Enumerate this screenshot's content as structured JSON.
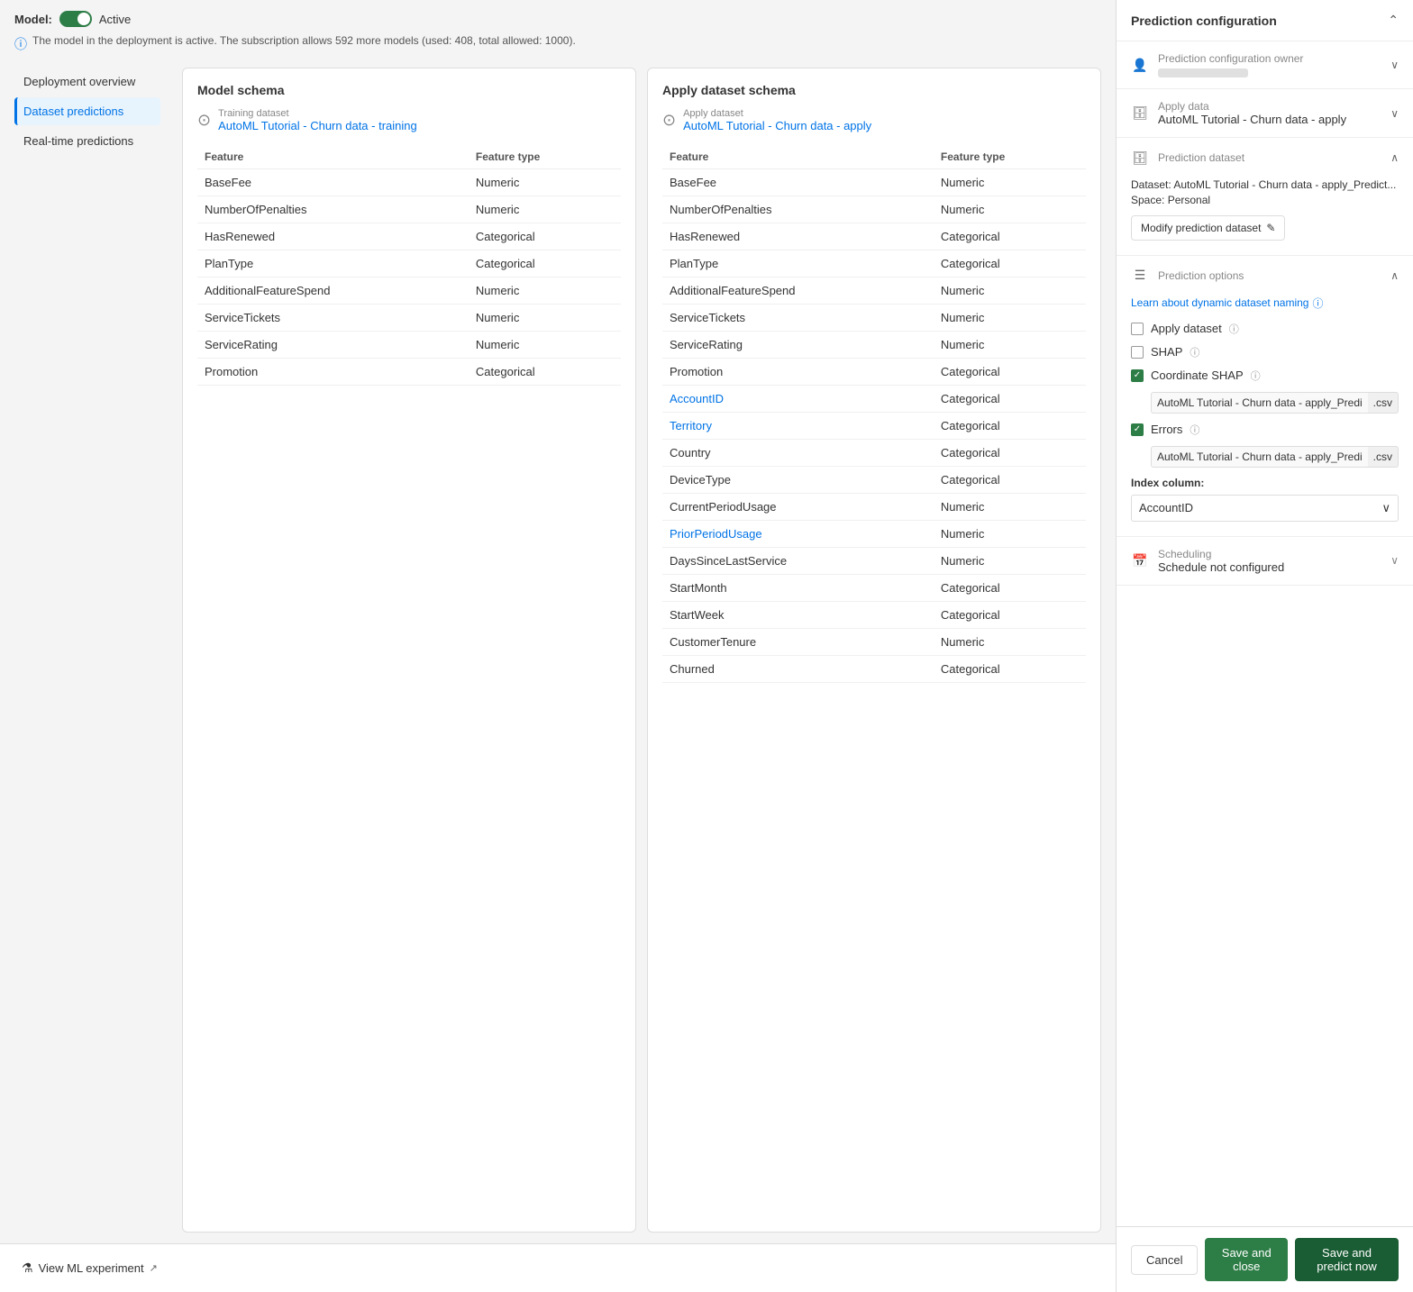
{
  "model": {
    "label": "Model:",
    "status": "Active",
    "info_text": "The model in the deployment is active. The subscription allows 592 more models (used: 408, total allowed: 1000)."
  },
  "sidebar": {
    "items": [
      {
        "id": "deployment-overview",
        "label": "Deployment overview",
        "active": false
      },
      {
        "id": "dataset-predictions",
        "label": "Dataset predictions",
        "active": true
      },
      {
        "id": "real-time-predictions",
        "label": "Real-time predictions",
        "active": false
      }
    ]
  },
  "model_schema": {
    "title": "Model schema",
    "dataset_label": "Training dataset",
    "dataset_name": "AutoML Tutorial - Churn data - training",
    "col_feature": "Feature",
    "col_feature_type": "Feature type",
    "rows": [
      {
        "feature": "BaseFee",
        "type": "Numeric",
        "linked": false
      },
      {
        "feature": "NumberOfPenalties",
        "type": "Numeric",
        "linked": false
      },
      {
        "feature": "HasRenewed",
        "type": "Categorical",
        "linked": false
      },
      {
        "feature": "PlanType",
        "type": "Categorical",
        "linked": false
      },
      {
        "feature": "AdditionalFeatureSpend",
        "type": "Numeric",
        "linked": false
      },
      {
        "feature": "ServiceTickets",
        "type": "Numeric",
        "linked": false
      },
      {
        "feature": "ServiceRating",
        "type": "Numeric",
        "linked": false
      },
      {
        "feature": "Promotion",
        "type": "Categorical",
        "linked": false
      }
    ]
  },
  "apply_schema": {
    "title": "Apply dataset schema",
    "dataset_label": "Apply dataset",
    "dataset_name": "AutoML Tutorial - Churn data - apply",
    "col_feature": "Feature",
    "col_feature_type": "Feature type",
    "rows": [
      {
        "feature": "BaseFee",
        "type": "Numeric",
        "linked": false
      },
      {
        "feature": "NumberOfPenalties",
        "type": "Numeric",
        "linked": false
      },
      {
        "feature": "HasRenewed",
        "type": "Categorical",
        "linked": false
      },
      {
        "feature": "PlanType",
        "type": "Categorical",
        "linked": false
      },
      {
        "feature": "AdditionalFeatureSpend",
        "type": "Numeric",
        "linked": false
      },
      {
        "feature": "ServiceTickets",
        "type": "Numeric",
        "linked": false
      },
      {
        "feature": "ServiceRating",
        "type": "Numeric",
        "linked": false
      },
      {
        "feature": "Promotion",
        "type": "Categorical",
        "linked": false
      },
      {
        "feature": "AccountID",
        "type": "Categorical",
        "linked": true
      },
      {
        "feature": "Territory",
        "type": "Categorical",
        "linked": true
      },
      {
        "feature": "Country",
        "type": "Categorical",
        "linked": false
      },
      {
        "feature": "DeviceType",
        "type": "Categorical",
        "linked": false
      },
      {
        "feature": "CurrentPeriodUsage",
        "type": "Numeric",
        "linked": false
      },
      {
        "feature": "PriorPeriodUsage",
        "type": "Numeric",
        "linked": true
      },
      {
        "feature": "DaysSinceLastService",
        "type": "Numeric",
        "linked": false
      },
      {
        "feature": "StartMonth",
        "type": "Categorical",
        "linked": false
      },
      {
        "feature": "StartWeek",
        "type": "Categorical",
        "linked": false
      },
      {
        "feature": "CustomerTenure",
        "type": "Numeric",
        "linked": false
      },
      {
        "feature": "Churned",
        "type": "Categorical",
        "linked": false
      }
    ]
  },
  "view_experiment": {
    "label": "View ML experiment",
    "icon": "flask"
  },
  "right_panel": {
    "title": "Prediction configuration",
    "window_icon": "□",
    "sections": {
      "owner": {
        "label": "Prediction configuration owner",
        "value": ""
      },
      "apply_data": {
        "label": "Apply data",
        "value": "AutoML Tutorial - Churn data - apply"
      },
      "prediction_dataset": {
        "label": "Prediction dataset",
        "dataset_text": "Dataset: AutoML Tutorial - Churn data - apply_Predict...",
        "space_text": "Space: Personal",
        "modify_label": "Modify prediction dataset"
      },
      "prediction_options": {
        "label": "Prediction options",
        "learn_link": "Learn about dynamic dataset naming",
        "options": [
          {
            "id": "apply-dataset",
            "label": "Apply dataset",
            "checked": false,
            "has_info": true
          },
          {
            "id": "shap",
            "label": "SHAP",
            "checked": false,
            "has_info": true
          },
          {
            "id": "coordinate-shap",
            "label": "Coordinate SHAP",
            "checked": true,
            "has_info": true,
            "sub_input": "AutoML Tutorial - Churn data - apply_Predictic",
            "sub_suffix": ".csv"
          },
          {
            "id": "errors",
            "label": "Errors",
            "checked": true,
            "has_info": true,
            "sub_input": "AutoML Tutorial - Churn data - apply_Predictic",
            "sub_suffix": ".csv"
          }
        ],
        "index_label": "Index column:",
        "index_value": "AccountID"
      },
      "scheduling": {
        "label": "Scheduling",
        "value": "Schedule not configured"
      }
    },
    "buttons": {
      "cancel": "Cancel",
      "save_close": "Save and close",
      "save_predict": "Save and predict now"
    }
  }
}
